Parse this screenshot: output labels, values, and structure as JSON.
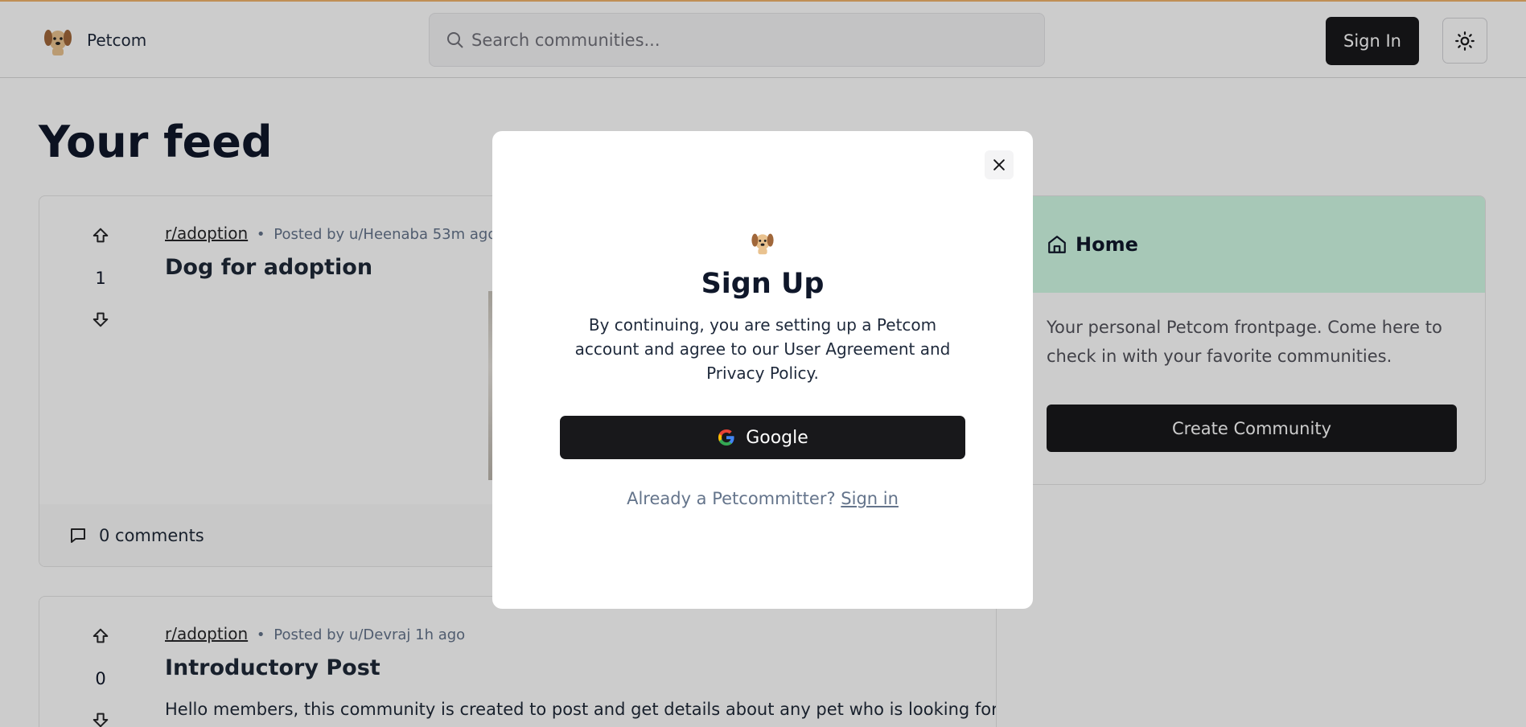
{
  "header": {
    "brand_name": "Petcom",
    "search_placeholder": "Search communities...",
    "signin_label": "Sign In"
  },
  "feed": {
    "title": "Your feed",
    "posts": [
      {
        "subreddit": "r/adoption",
        "posted_by": "Posted by u/Heenaba 53m ago",
        "title": "Dog for adoption",
        "votes": "1",
        "comments": "0 comments"
      },
      {
        "subreddit": "r/adoption",
        "posted_by": "Posted by u/Devraj 1h ago",
        "title": "Introductory Post",
        "votes": "0",
        "body": "Hello members, this community is created to post and get details about any pet who is looking for"
      }
    ]
  },
  "sidebar": {
    "title": "Home",
    "description": "Your personal Petcom frontpage. Come here to check in with your favorite communities.",
    "create_label": "Create Community"
  },
  "modal": {
    "title": "Sign Up",
    "text": "By continuing, you are setting up a Petcom account and agree to our User Agreement and Privacy Policy.",
    "google_label": "Google",
    "already_text": "Already a Petcommitter?",
    "signin_link": "Sign in"
  },
  "colors": {
    "accent_dark": "#18181b",
    "sidebar_header": "#d1fae5",
    "top_border": "#f0b36b"
  }
}
